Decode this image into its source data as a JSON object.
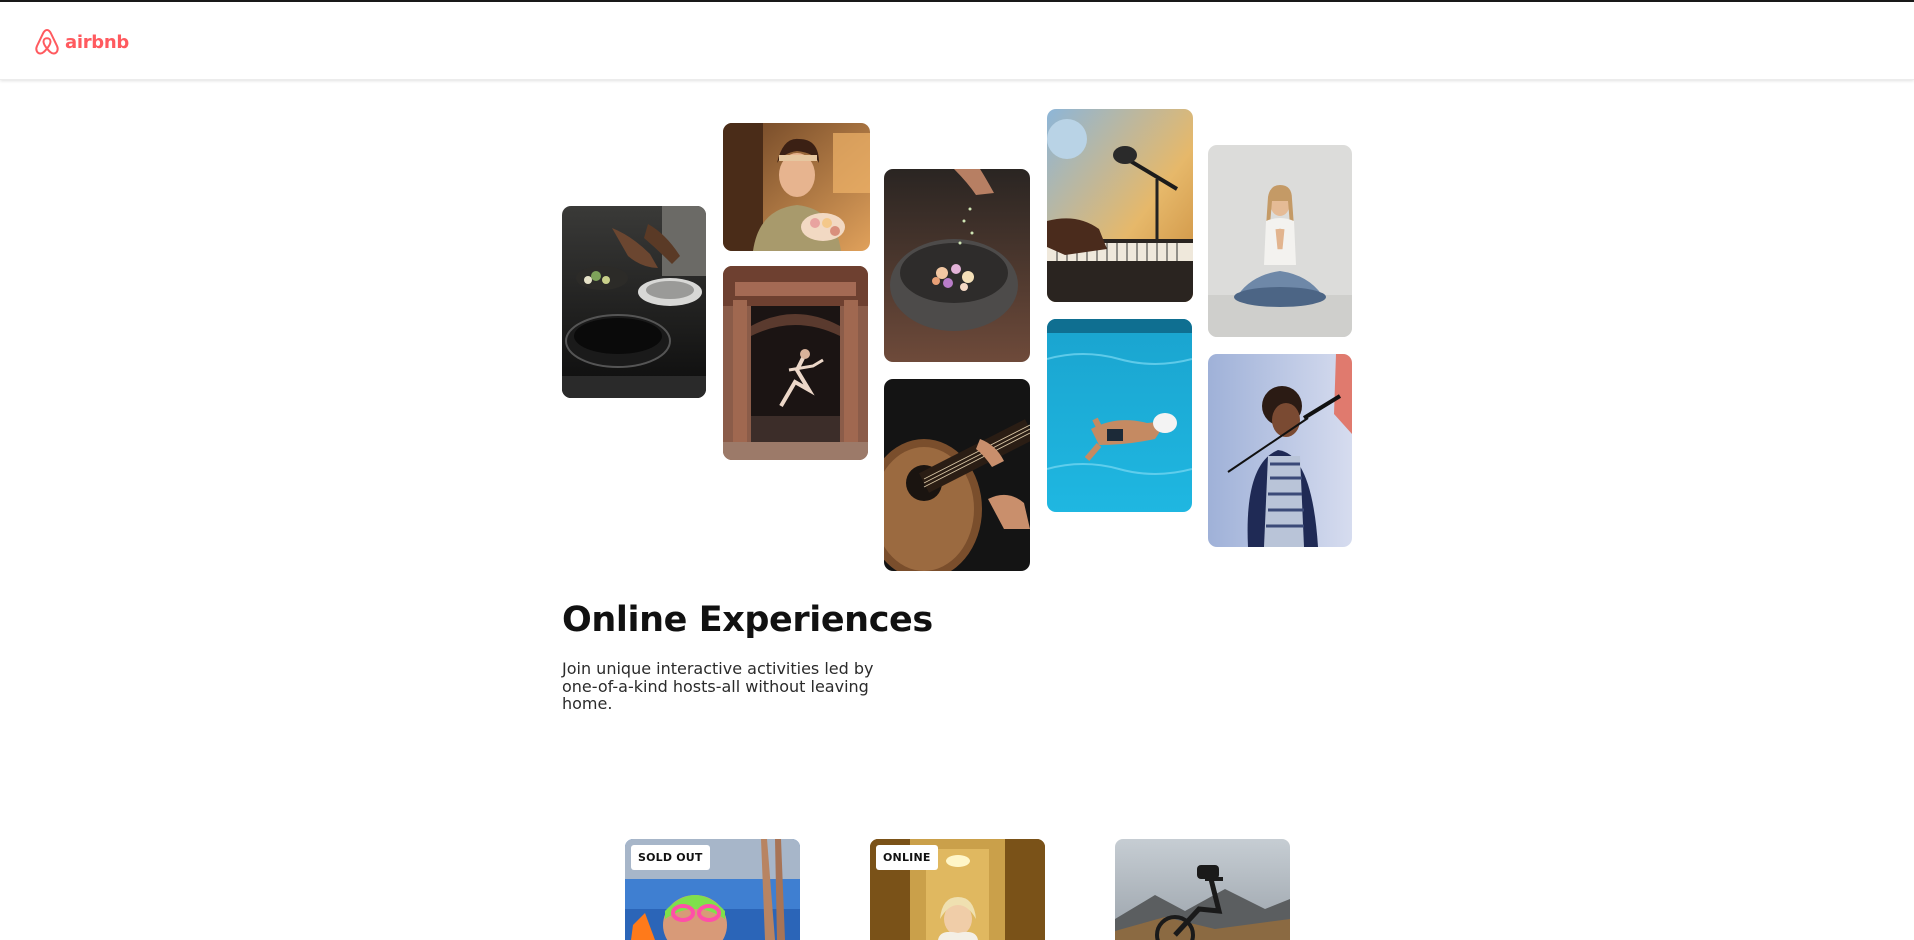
{
  "brand": {
    "name": "airbnb",
    "color": "#ff5a5f",
    "icon": "airbnb-logo-icon"
  },
  "gallery": {
    "images": [
      {
        "subject": "cooking-pans-photo"
      },
      {
        "subject": "woman-holding-pastries-photo"
      },
      {
        "subject": "dancer-in-doorway-photo"
      },
      {
        "subject": "seasoning-bowl-photo"
      },
      {
        "subject": "acoustic-guitar-photo"
      },
      {
        "subject": "piano-microphone-photo"
      },
      {
        "subject": "swimmer-pool-photo"
      },
      {
        "subject": "yoga-meditation-photo"
      },
      {
        "subject": "singer-microphone-photo"
      }
    ]
  },
  "hero": {
    "title": "Online Experiences",
    "subtitle": "Join unique interactive activities led by one-of-a-kind hosts-all without leaving home."
  },
  "cards": [
    {
      "badge": "SOLD OUT",
      "subject": "swimmer-athlete-photo"
    },
    {
      "badge": "ONLINE",
      "subject": "bride-photo"
    },
    {
      "badge": "",
      "subject": "mountain-bike-photo"
    }
  ]
}
